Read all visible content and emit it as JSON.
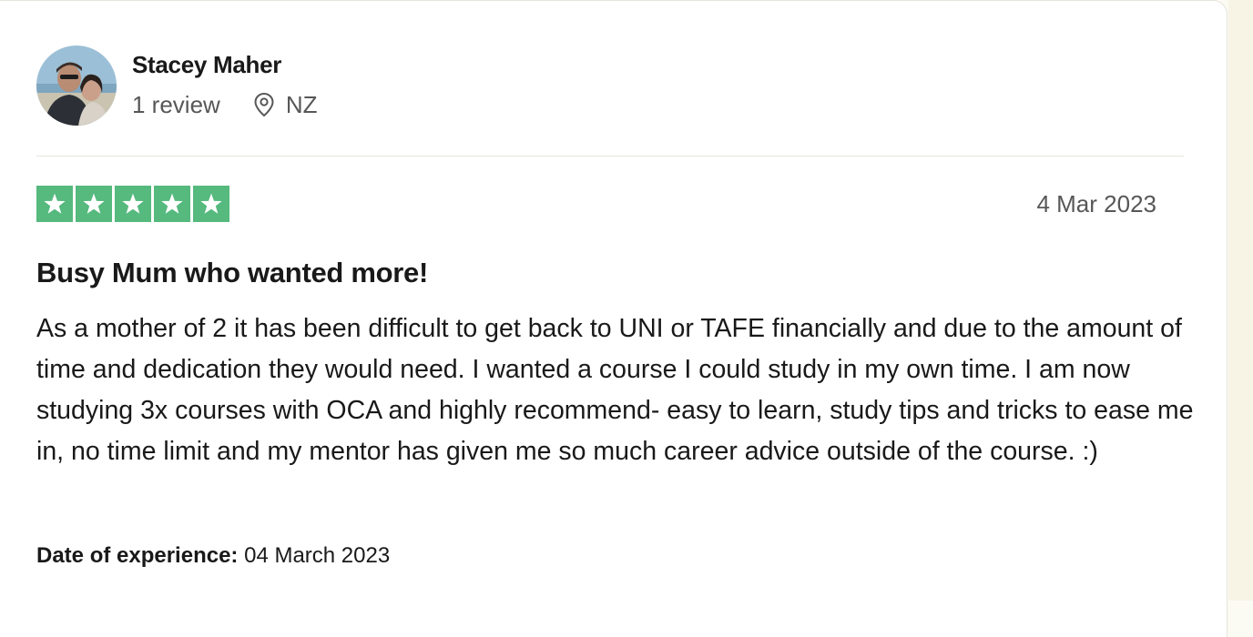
{
  "reviewer": {
    "name": "Stacey Maher",
    "review_count": "1 review",
    "country": "NZ"
  },
  "rating": {
    "stars": 5,
    "max": 5,
    "color": "#56b97e"
  },
  "review": {
    "date": "4 Mar 2023",
    "title": "Busy Mum who wanted more!",
    "body": "As a mother of 2 it has been difficult to get back to UNI or TAFE financially and due to the amount of time and dedication they would need. I wanted a course I could study in my own time. I am now studying 3x courses with OCA and highly recommend- easy to learn, study tips and tricks to ease me in, no time limit and my mentor has given me so much career advice outside of the course. :)",
    "experience_label": "Date of experience:",
    "experience_date": "04 March 2023"
  },
  "icons": {
    "location": "location-pin-icon",
    "star": "star-icon"
  }
}
